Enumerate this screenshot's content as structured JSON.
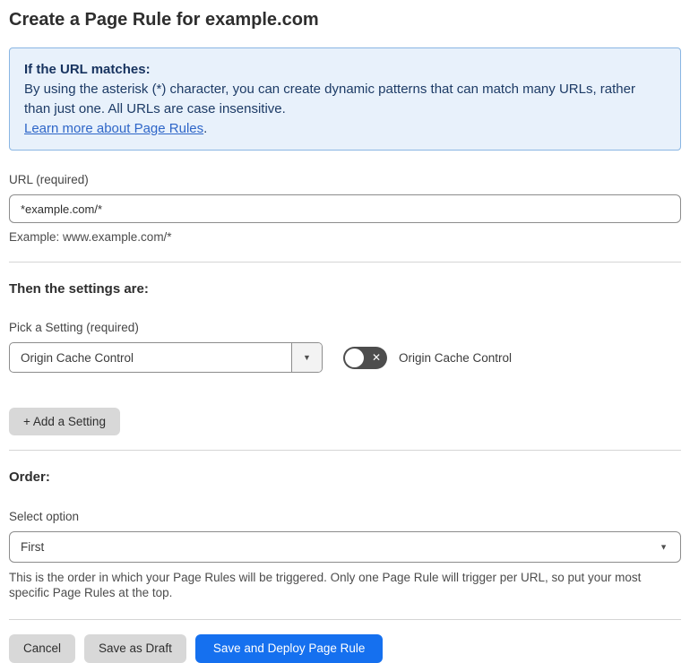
{
  "page": {
    "title": "Create a Page Rule for example.com"
  },
  "info_box": {
    "heading": "If the URL matches:",
    "body": "By using the asterisk (*) character, you can create dynamic patterns that can match many URLs, rather than just one. All URLs are case insensitive.",
    "link_text": "Learn more about Page Rules",
    "link_suffix": "."
  },
  "url_field": {
    "label": "URL (required)",
    "value": "*example.com/*",
    "example": "Example: www.example.com/*"
  },
  "settings_section": {
    "heading": "Then the settings are:",
    "picker_label": "Pick a Setting (required)",
    "picker_value": "Origin Cache Control",
    "toggle_label": "Origin Cache Control",
    "toggle_state": "off",
    "add_setting_button": "+ Add a Setting"
  },
  "order_section": {
    "heading": "Order:",
    "select_label": "Select option",
    "select_value": "First",
    "help_text": "This is the order in which your Page Rules will be triggered. Only one Page Rule will trigger per URL, so put your most specific Page Rules at the top."
  },
  "footer": {
    "cancel_button": "Cancel",
    "save_draft_button": "Save as Draft",
    "save_deploy_button": "Save and Deploy Page Rule"
  },
  "icons": {
    "dropdown_arrow": "▼",
    "toggle_off_x": "✕"
  },
  "colors": {
    "primary_button": "#1570ef",
    "info_box_bg": "#e8f1fb",
    "info_box_border": "#8ab6e3",
    "info_text": "#1d3b66",
    "link": "#2e66c8",
    "toggle_off_bg": "#4d4d4d",
    "gray_button_bg": "#d8d8d8",
    "divider": "#d5d5d5"
  }
}
